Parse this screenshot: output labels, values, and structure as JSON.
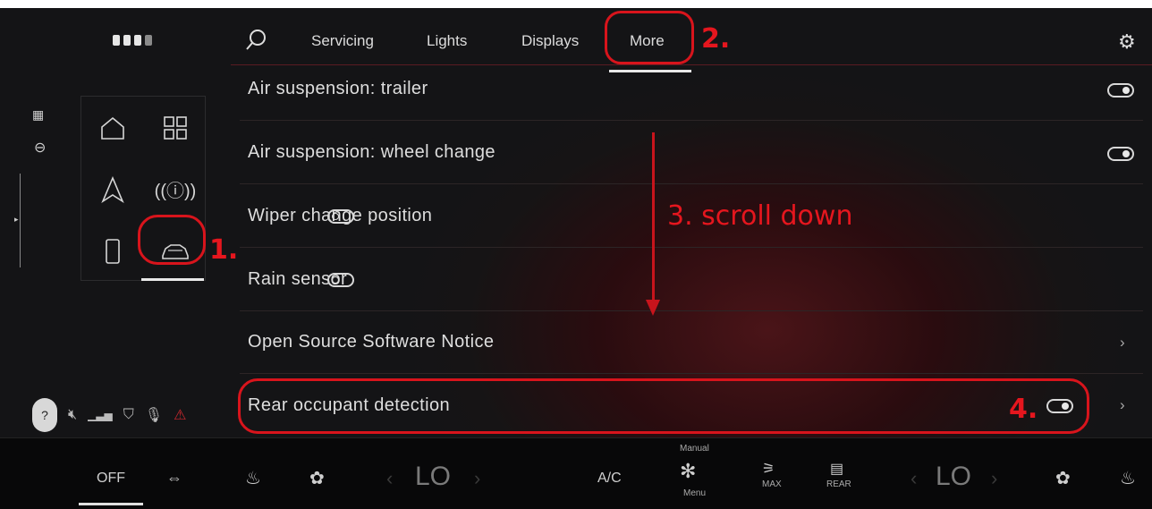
{
  "left_sidebar": {
    "page_dots": 4,
    "grid_icons": [
      "home-icon",
      "apps-grid-icon",
      "navigation-icon",
      "radio-icon",
      "phone-icon",
      "car-icon"
    ],
    "status_icons": [
      "user-profile-icon",
      "mute-icon",
      "signal-icon",
      "privacy-icon",
      "microphone-icon",
      "warning-icon"
    ]
  },
  "tabs": {
    "items": [
      "Servicing",
      "Lights",
      "Displays",
      "More"
    ],
    "selected": "More"
  },
  "settings_list": [
    {
      "label": "Air suspension: trailer",
      "control": "toggle-on"
    },
    {
      "label": "Air suspension: wheel change",
      "control": "toggle-on"
    },
    {
      "label": "Wiper change position",
      "control": "toggle-off"
    },
    {
      "label": "Rain sensor",
      "control": "toggle-off"
    },
    {
      "label": "Open Source Software Notice",
      "control": "chevron"
    },
    {
      "label": "Rear occupant detection",
      "control": "toggle-on-chevron"
    }
  ],
  "annotations": {
    "step1": "1.",
    "step2": "2.",
    "step3": "3. scroll down",
    "step4": "4."
  },
  "climate": {
    "off": "OFF",
    "left_temp": "LO",
    "right_temp": "LO",
    "ac": "A/C",
    "manual": "Manual",
    "menu": "Menu",
    "max": "MAX",
    "rear": "REAR"
  },
  "colors": {
    "annotation_red": "#d8141c",
    "accent_red": "#5a1b22",
    "background": "#141416"
  }
}
